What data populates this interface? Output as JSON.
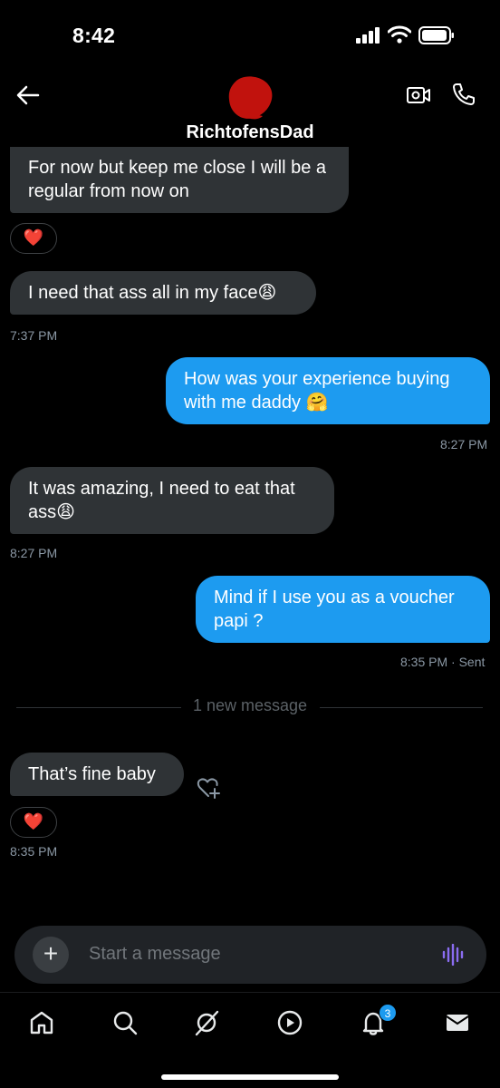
{
  "status_bar": {
    "time": "8:42"
  },
  "header": {
    "title": "RichtofensDad",
    "back_icon": "arrow-left-icon",
    "video_icon": "video-call-icon",
    "phone_icon": "phone-icon"
  },
  "messages": [
    {
      "direction": "in",
      "text": "For now but keep me close I will be a regular from now on",
      "reaction": "❤️"
    },
    {
      "direction": "in",
      "text": "I need that ass all in my face😩",
      "time": "7:37 PM"
    },
    {
      "direction": "out",
      "text": "How was your experience buying with me daddy 🤗",
      "time": "8:27 PM"
    },
    {
      "direction": "in",
      "text": "It was amazing, I need to eat that ass😩",
      "time": "8:27 PM"
    },
    {
      "direction": "out",
      "text": "Mind if I use you as a voucher papi ?",
      "time": "8:35 PM",
      "status": "· Sent"
    },
    {
      "direction": "in",
      "text": "That’s fine baby",
      "reaction": "❤️",
      "time": "8:35 PM"
    }
  ],
  "divider_label": "1 new message",
  "composer": {
    "placeholder": "Start a message",
    "plus": "+"
  },
  "nav": {
    "notifications_badge": "3"
  },
  "colors": {
    "accent": "#1d9bf0",
    "incoming_bubble": "#2f3336",
    "voice_icon": "#8a6cf0"
  }
}
